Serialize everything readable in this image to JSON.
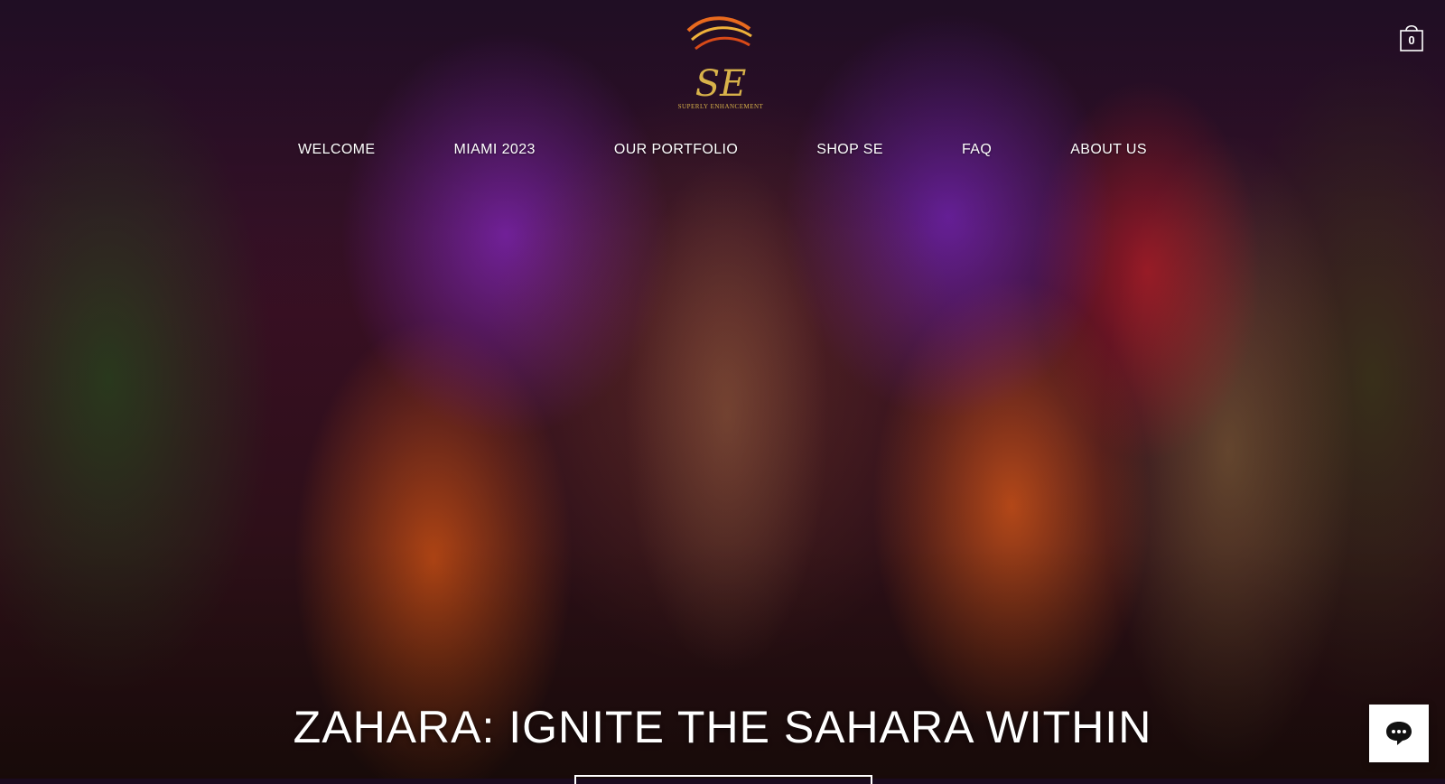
{
  "logo": {
    "monogram": "SE",
    "brand_text": "SUPERLY ENHANCEMENT"
  },
  "nav": {
    "items": [
      {
        "label": "WELCOME"
      },
      {
        "label": "MIAMI 2023"
      },
      {
        "label": "OUR PORTFOLIO"
      },
      {
        "label": "SHOP SE"
      },
      {
        "label": "FAQ"
      },
      {
        "label": "ABOUT US"
      }
    ]
  },
  "cart": {
    "count": "0",
    "icon": "shopping-bag-icon"
  },
  "hero": {
    "headline": "ZAHARA: IGNITE THE SAHARA WITHIN"
  },
  "chat": {
    "icon": "chat-bubble-icon"
  },
  "colors": {
    "accent_gold": "#d8b24a",
    "text": "#ffffff",
    "chat_bg": "#ffffff"
  }
}
